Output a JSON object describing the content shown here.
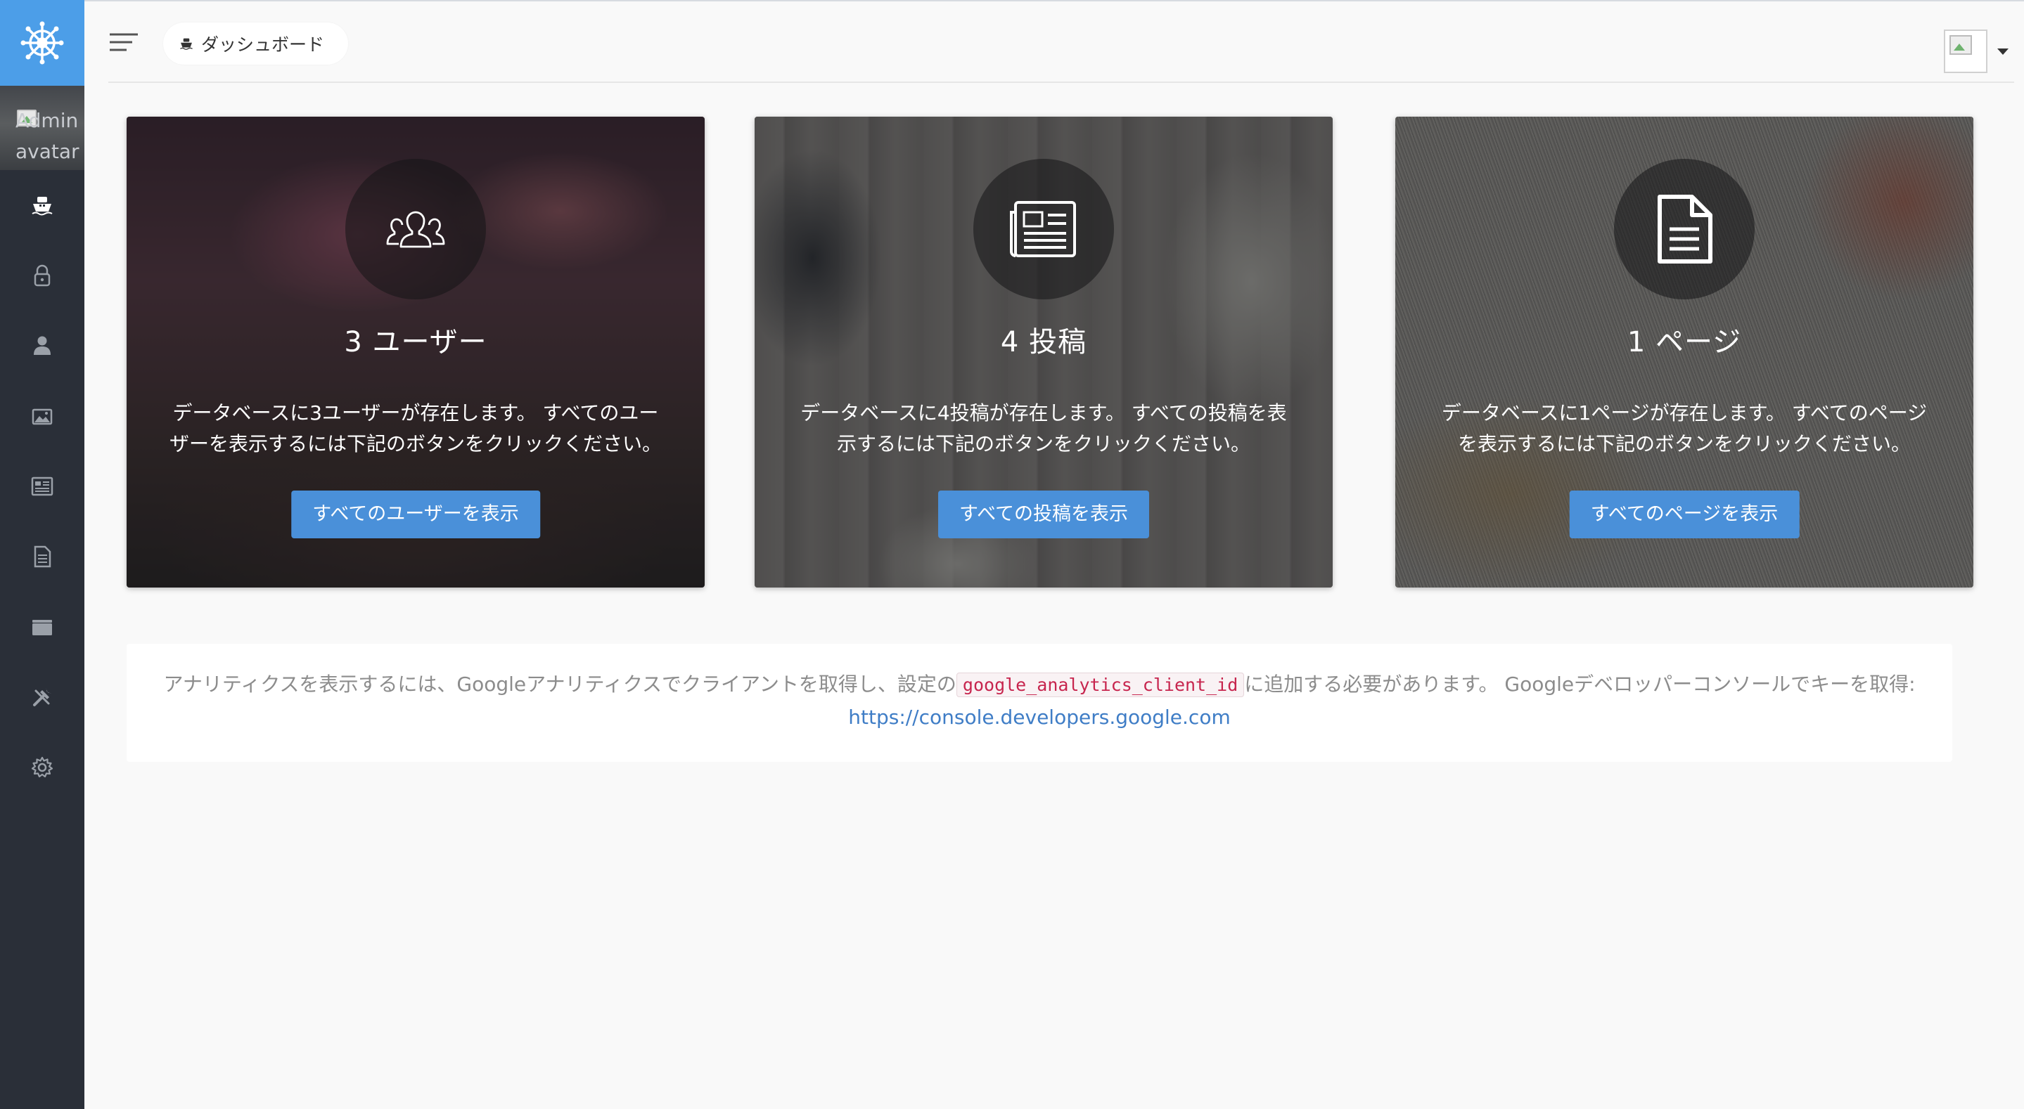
{
  "sidebar": {
    "brand_icon": "ship-wheel-icon",
    "avatar_alt": "Admin avatar",
    "items": [
      {
        "id": "dashboard",
        "icon": "boat-icon",
        "active": true
      },
      {
        "id": "roles",
        "icon": "lock-icon",
        "active": false
      },
      {
        "id": "users",
        "icon": "person-icon",
        "active": false
      },
      {
        "id": "media",
        "icon": "images-icon",
        "active": false
      },
      {
        "id": "posts",
        "icon": "news-icon",
        "active": false
      },
      {
        "id": "pages",
        "icon": "document-icon",
        "active": false
      },
      {
        "id": "categories",
        "icon": "folder-icon",
        "active": false
      },
      {
        "id": "tools",
        "icon": "tools-icon",
        "active": false
      },
      {
        "id": "settings",
        "icon": "gear-icon",
        "active": false
      }
    ]
  },
  "topbar": {
    "breadcrumb_label": "ダッシュボード"
  },
  "cards": {
    "users": {
      "title": "3 ユーザー",
      "description": "データベースに3ユーザーが存在します。 すべてのユーザーを表示するには下記のボタンをクリックください。",
      "button": "すべてのユーザーを表示"
    },
    "posts": {
      "title": "4 投稿",
      "description": "データベースに4投稿が存在します。 すべての投稿を表示するには下記のボタンをクリックください。",
      "button": "すべての投稿を表示"
    },
    "pages": {
      "title": "1 ページ",
      "description": "データベースに1ページが存在します。 すべてのページを表示するには下記のボタンをクリックください。",
      "button": "すべてのページを表示"
    }
  },
  "analytics": {
    "text_before": "アナリティクスを表示するには、Googleアナリティクスでクライアントを取得し、設定の",
    "code": "google_analytics_client_id",
    "text_after": "に追加する必要があります。 Googleデベロッパーコンソールでキーを取得:",
    "link": "https://console.developers.google.com"
  },
  "colors": {
    "sidebar_bg": "#2a2f38",
    "brand_bg": "#4c9ee8",
    "button_primary": "#4a90d9",
    "link": "#3f7dc6",
    "code_text": "#c7254e"
  }
}
